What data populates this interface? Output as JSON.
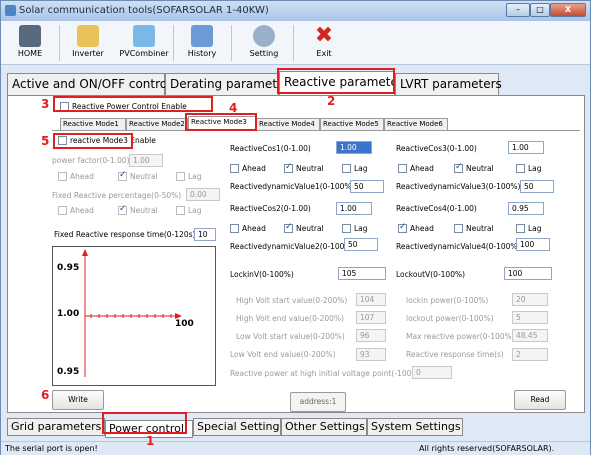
{
  "window": {
    "title": "Solar communication tools(SOFARSOLAR 1-40KW)",
    "min": "–",
    "max": "□",
    "close": "X"
  },
  "toolbar": {
    "home": "HOME",
    "inverter": "Inverter",
    "pvcombiner": "PVCombiner",
    "history": "History",
    "setting": "Setting",
    "exit": "Exit"
  },
  "tabs_top": [
    "Active and ON/OFF control",
    "Derating parameters",
    "Reactive parameters",
    "LVRT parameters"
  ],
  "reactive_enable": "Reactive Power Control Enable",
  "modes": [
    "Reactive Mode1",
    "Reactive Mode2",
    "Reactive Mode3",
    "Reactive Mode4",
    "Reactive Mode5",
    "Reactive Mode6"
  ],
  "left": {
    "mode_enable": "reactive Mode3 Enable",
    "pf_label": "power factor(0-1.00)",
    "pf_value": "1.00",
    "ahead": "Ahead",
    "neutral": "Neutral",
    "lag": "Lag",
    "fixed_pct_label": "Fixed Reactive percentage(0-50%)",
    "fixed_pct_value": "0.00",
    "resp_label": "Fixed Reactive response time(0-120s)",
    "resp_value": "10"
  },
  "graph": {
    "y_high": "0.95",
    "y_mid": "1.00",
    "y_low": "0.95",
    "x_label": "100"
  },
  "cos": {
    "c1_label": "ReactiveCos1(0-1.00)",
    "c1_value": "1.00",
    "c3_label": "ReactiveCos3(0-1.00)",
    "c3_value": "1.00",
    "dv1_label": "ReactivedynamicValue1(0-100%)",
    "dv1_value": "50",
    "dv3_label": "ReactivedynamicValue3(0-100%)",
    "dv3_value": "50",
    "c2_label": "ReactiveCos2(0-1.00)",
    "c2_value": "1.00",
    "c4_label": "ReactiveCos4(0-1.00)",
    "c4_value": "0.95",
    "dv2_label": "ReactivedynamicValue2(0-100%)",
    "dv2_value": "50",
    "dv4_label": "ReactivedynamicValue4(0-100%)",
    "dv4_value": "100"
  },
  "lock": {
    "lockin_label": "LockinV(0-100%)",
    "lockin_value": "105",
    "lockout_label": "LockoutV(0-100%)",
    "lockout_value": "100"
  },
  "volt": {
    "hvs_label": "High Volt start value(0-200%)",
    "hvs_value": "104",
    "hve_label": "High Volt end value(0-200%)",
    "hve_value": "107",
    "lvs_label": "Low Volt start value(0-200%)",
    "lvs_value": "96",
    "lve_label": "Low Volt end value(0-200%)",
    "lve_value": "93",
    "lip_label": "lockin power(0-100%)",
    "lip_value": "20",
    "lop_label": "lockout power(0-100%)",
    "lop_value": "5",
    "mrp_label": "Max reactive power(0-100%)",
    "mrp_value": "48.45",
    "rrt_label": "Reactive response time(s)",
    "rrt_value": "2",
    "rphv_label": "Reactive power at high initial voltage point(-100%-100%)",
    "rphv_value": "0"
  },
  "buttons": {
    "write": "Write",
    "read": "Read",
    "address": "address:1"
  },
  "tabs_bottom": [
    "Grid parameters",
    "Power control",
    "Special Setting",
    "Other Settings",
    "System Settings"
  ],
  "status": {
    "left": "The serial port is open!",
    "right": "All rights reserved(SOFARSOLAR)."
  },
  "annotations": [
    "1",
    "2",
    "3",
    "4",
    "5",
    "6"
  ],
  "colors": {
    "annotation": "#e02020",
    "selection": "#3b74c9"
  }
}
